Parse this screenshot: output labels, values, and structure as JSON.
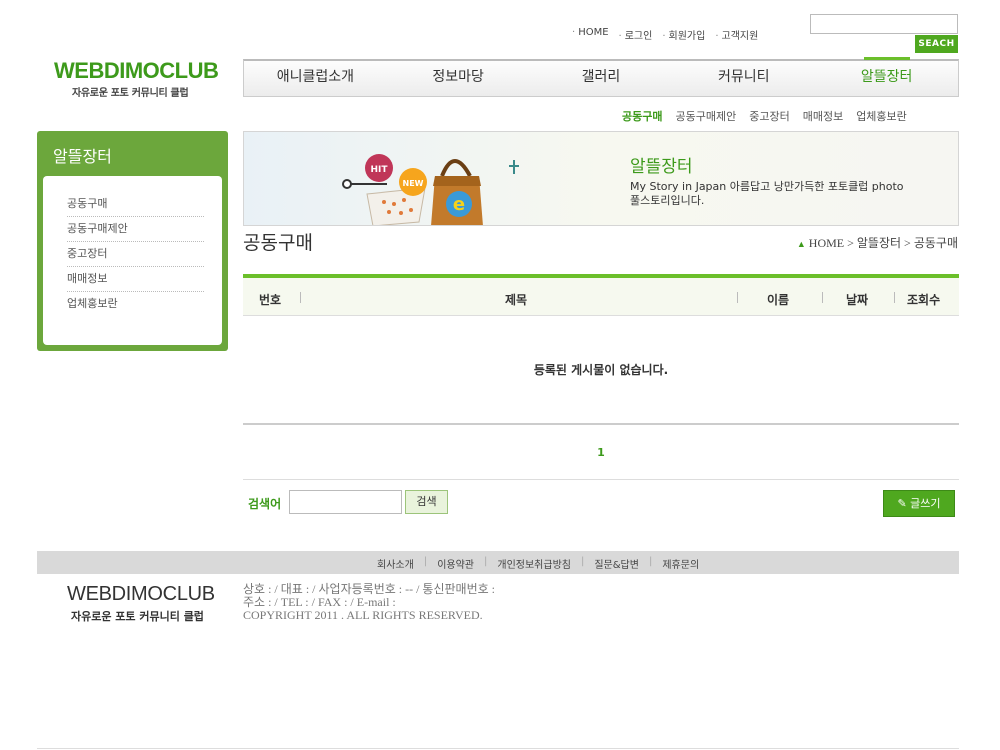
{
  "header": {
    "top_links": [
      "HOME",
      "로그인",
      "회원가입",
      "고객지원"
    ],
    "search_button": "SEACH",
    "logo_title": "WEBDIMOCLUB",
    "logo_sub": "자유로운 포토 커뮤니티 클럽"
  },
  "gnb": [
    "애니클럽소개",
    "정보마당",
    "갤러리",
    "커뮤니티",
    "알뜰장터"
  ],
  "snb": [
    "공동구매",
    "공동구매제안",
    "중고장터",
    "매매정보",
    "업체홍보란"
  ],
  "lnb": {
    "title": "알뜰장터",
    "items": [
      "공동구매",
      "공동구매제안",
      "중고장터",
      "매매정보",
      "업체홍보란"
    ]
  },
  "banner": {
    "badge_hit": "HIT",
    "badge_new": "NEW",
    "title": "알뜰장터",
    "desc_line1": "My Story in Japan 아름답고 낭만가득한  포토클럽 photo",
    "desc_line2": "풀스토리입니다."
  },
  "page": {
    "title": "공동구매",
    "breadcrumb": "HOME > 알뜰장터 > 공동구매"
  },
  "board": {
    "columns": [
      "번호",
      "제목",
      "이름",
      "날짜",
      "조회수"
    ],
    "empty_message": "등록된 게시물이 없습니다.",
    "page": "1"
  },
  "search": {
    "label": "검색어",
    "button": "검색",
    "write_button": "글쓰기"
  },
  "footer": {
    "links": [
      "회사소개",
      "이용약관",
      "개인정보취급방침",
      "질문&답변",
      "제휴문의"
    ],
    "logo_title": "WEBDIMOCLUB",
    "logo_sub": "자유로운 포토 커뮤니티 클럽",
    "info_line1": "상호 : / 대표 : / 사업자등록번호 : -- / 통신판매번호 :",
    "info_line2": "주소 : / TEL : / FAX : / E-mail :",
    "info_line3": "COPYRIGHT 2011 . ALL RIGHTS RESERVED."
  }
}
